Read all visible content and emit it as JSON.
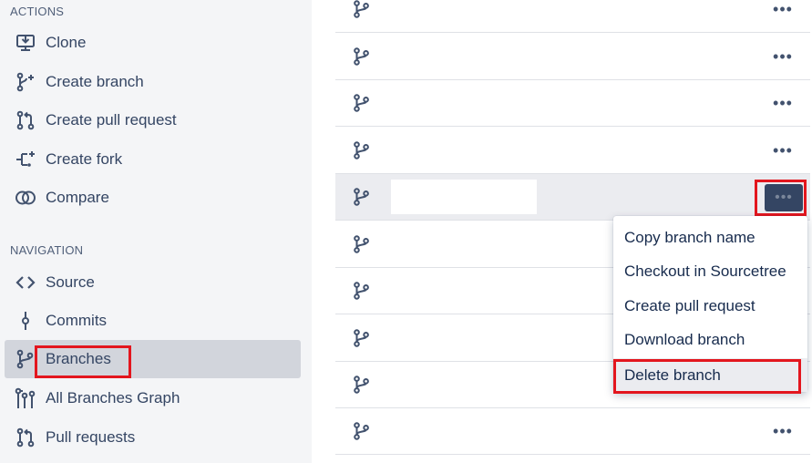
{
  "sidebar": {
    "actions_title": "ACTIONS",
    "actions": [
      {
        "label": "Clone",
        "icon": "clone-icon"
      },
      {
        "label": "Create branch",
        "icon": "create-branch-icon"
      },
      {
        "label": "Create pull request",
        "icon": "pull-request-icon"
      },
      {
        "label": "Create fork",
        "icon": "fork-icon"
      },
      {
        "label": "Compare",
        "icon": "compare-icon"
      }
    ],
    "navigation_title": "NAVIGATION",
    "navigation": [
      {
        "label": "Source",
        "icon": "source-code-icon"
      },
      {
        "label": "Commits",
        "icon": "commit-icon"
      },
      {
        "label": "Branches",
        "icon": "branch-icon",
        "active": true
      },
      {
        "label": "All Branches Graph",
        "icon": "branches-graph-icon"
      },
      {
        "label": "Pull requests",
        "icon": "pull-request-icon"
      }
    ]
  },
  "branch_list": {
    "more_label": "•••",
    "row_count": 10,
    "selected_row": 5
  },
  "menu": {
    "items": [
      {
        "label": "Copy branch name"
      },
      {
        "label": "Checkout in Sourcetree"
      },
      {
        "label": "Create pull request"
      },
      {
        "label": "Download branch"
      },
      {
        "label": "Delete branch",
        "hover": true
      }
    ]
  },
  "colors": {
    "sidebar_bg": "#f4f5f7",
    "active_bg": "#d2d5dc",
    "highlight": "#e3161e",
    "icon": "#42526e",
    "text": "#172b4d"
  }
}
